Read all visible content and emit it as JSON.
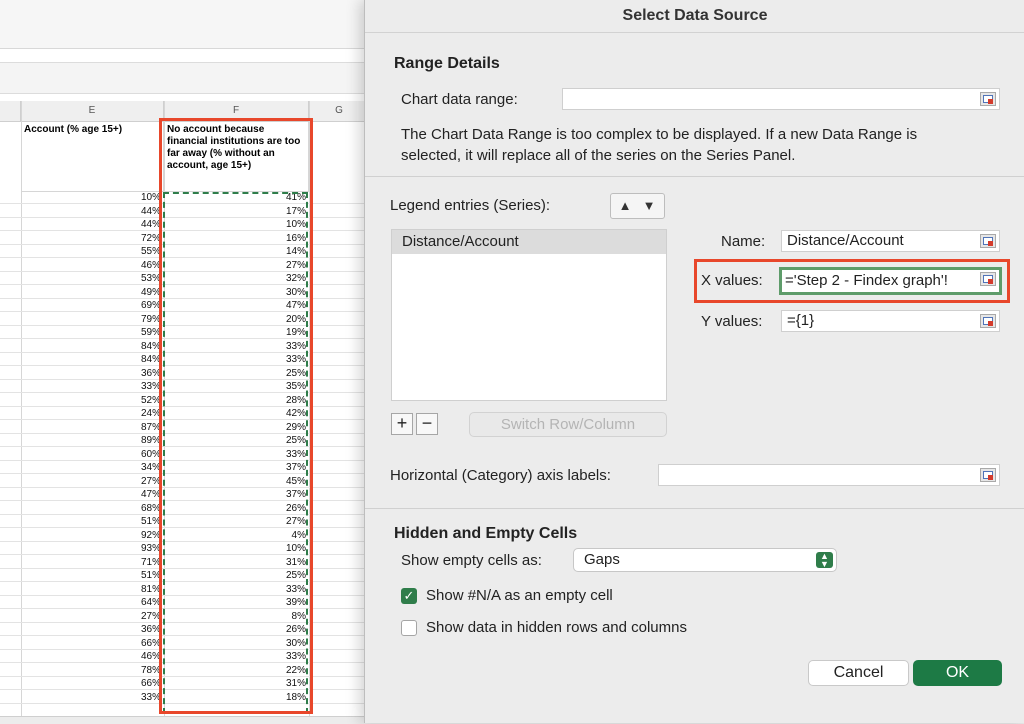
{
  "spreadsheet": {
    "col_e_letter": "E",
    "col_f_letter": "F",
    "col_g_letter": "G",
    "col_e_header": "Account (% age 15+)",
    "col_f_header": "No account because financial institutions are too far away (% without an account, age 15+)",
    "rows": [
      [
        "10%",
        "41%"
      ],
      [
        "44%",
        "17%"
      ],
      [
        "44%",
        "10%"
      ],
      [
        "72%",
        "16%"
      ],
      [
        "55%",
        "14%"
      ],
      [
        "46%",
        "27%"
      ],
      [
        "53%",
        "32%"
      ],
      [
        "49%",
        "30%"
      ],
      [
        "69%",
        "47%"
      ],
      [
        "79%",
        "20%"
      ],
      [
        "59%",
        "19%"
      ],
      [
        "84%",
        "33%"
      ],
      [
        "84%",
        "33%"
      ],
      [
        "36%",
        "25%"
      ],
      [
        "33%",
        "35%"
      ],
      [
        "52%",
        "28%"
      ],
      [
        "24%",
        "42%"
      ],
      [
        "87%",
        "29%"
      ],
      [
        "89%",
        "25%"
      ],
      [
        "60%",
        "33%"
      ],
      [
        "34%",
        "37%"
      ],
      [
        "27%",
        "45%"
      ],
      [
        "47%",
        "37%"
      ],
      [
        "68%",
        "26%"
      ],
      [
        "51%",
        "27%"
      ],
      [
        "92%",
        "4%"
      ],
      [
        "93%",
        "10%"
      ],
      [
        "71%",
        "31%"
      ],
      [
        "51%",
        "25%"
      ],
      [
        "81%",
        "33%"
      ],
      [
        "64%",
        "39%"
      ],
      [
        "27%",
        "8%"
      ],
      [
        "36%",
        "26%"
      ],
      [
        "66%",
        "30%"
      ],
      [
        "46%",
        "33%"
      ],
      [
        "78%",
        "22%"
      ],
      [
        "66%",
        "31%"
      ],
      [
        "33%",
        "18%"
      ]
    ]
  },
  "dialog": {
    "title": "Select Data Source",
    "range_details": {
      "heading": "Range Details",
      "chart_data_range_label": "Chart data range:",
      "chart_data_range_value": "",
      "message": "The Chart Data Range is too complex to be displayed. If a new Data Range is selected, it will replace all of the series on the Series Panel."
    },
    "legend": {
      "label": "Legend entries (Series):",
      "up_arrow": "▲",
      "down_arrow": "▼",
      "items": [
        "Distance/Account"
      ],
      "add_label": "+",
      "remove_label": "−",
      "switch_label": "Switch Row/Column"
    },
    "series_detail": {
      "name_label": "Name:",
      "name_value": "Distance/Account",
      "x_label": "X values:",
      "x_value": "='Step 2 - Findex graph'!",
      "y_label": "Y values:",
      "y_value": "={1}"
    },
    "category_axis": {
      "label": "Horizontal (Category) axis labels:",
      "value": ""
    },
    "hidden_empty": {
      "heading": "Hidden and Empty Cells",
      "show_empty_label": "Show empty cells as:",
      "show_empty_value": "Gaps",
      "na_label": "Show #N/A as an empty cell",
      "na_checked": true,
      "hidden_label": "Show data in hidden rows and columns",
      "hidden_checked": false,
      "check_glyph": "✓"
    },
    "buttons": {
      "cancel": "Cancel",
      "ok": "OK"
    }
  },
  "colors": {
    "highlight_red": "#e8472b",
    "accent_green": "#1d7a45",
    "field_green_border": "#5e9c6a"
  }
}
